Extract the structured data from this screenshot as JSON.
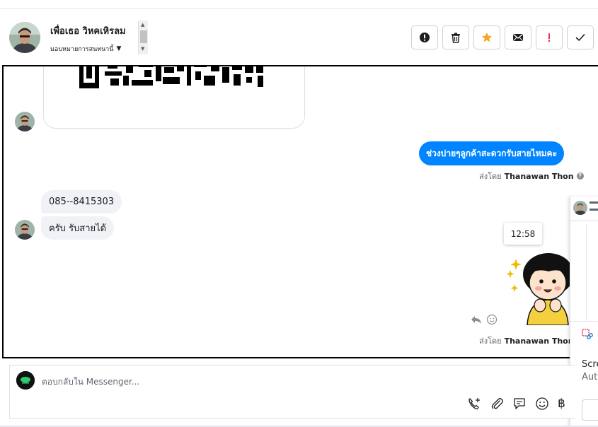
{
  "header": {
    "contact_name": "เพื่อเธอ วิหคเหิรลม",
    "assign_label": "มอบหมายการสนทนานี้",
    "actions": [
      {
        "name": "spam-button",
        "icon": "exclamation-circle-icon"
      },
      {
        "name": "delete-button",
        "icon": "trash-icon"
      },
      {
        "name": "star-button",
        "icon": "star-icon"
      },
      {
        "name": "mark-unread-button",
        "icon": "envelope-icon"
      },
      {
        "name": "follow-up-button",
        "icon": "exclamation-icon"
      },
      {
        "name": "mark-done-button",
        "icon": "check-icon"
      }
    ]
  },
  "conversation": {
    "outgoing_message": "ช่วงบ่ายๆลูกค้าสะดวกรับสายไหมคะ",
    "sent_by_prefix": "ส่งโดย",
    "sent_by_name": "Thanawan Thon",
    "incoming_phone": "085--8415303",
    "incoming_reply": "ครับ  รับสายได้",
    "timestamp_tooltip": "12:58",
    "sticker_description": "girl-sparkle-sticker"
  },
  "side_panel": {
    "title_partial": "Scre",
    "subtitle_partial": "Auto"
  },
  "composer": {
    "placeholder": "ตอบกลับใน Messenger...",
    "tools": [
      "add-call-icon",
      "paperclip-icon",
      "saved-reply-icon",
      "emoji-icon",
      "baht-icon"
    ],
    "baht_symbol": "฿"
  },
  "colors": {
    "accent_blue": "#0084ff",
    "star_orange": "#f5a623",
    "follow_up_red": "#e41e3f",
    "incoming_bubble": "#f0f2f5"
  }
}
